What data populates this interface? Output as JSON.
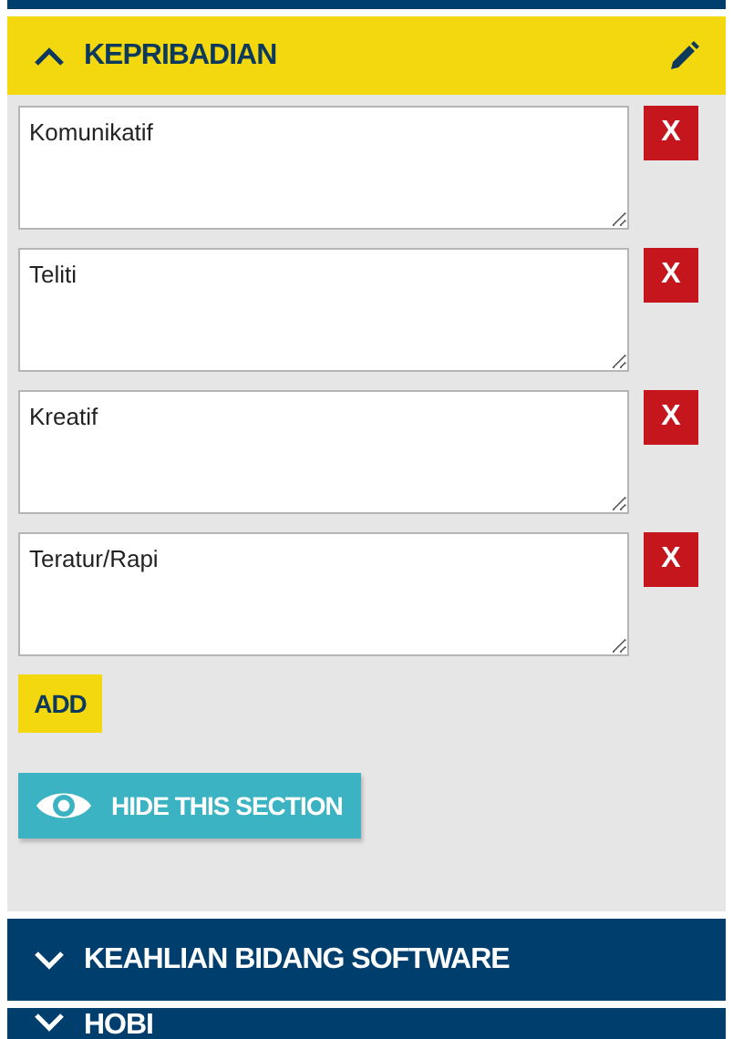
{
  "sections": [
    {
      "title": "KEPRIBADIAN",
      "expanded": true,
      "items": [
        {
          "value": "Komunikatif",
          "remove_label": "X"
        },
        {
          "value": "Teliti",
          "remove_label": "X"
        },
        {
          "value": "Kreatif",
          "remove_label": "X"
        },
        {
          "value": "Teratur/Rapi",
          "remove_label": "X"
        }
      ],
      "add_label": "ADD",
      "hide_label": "HIDE THIS SECTION"
    },
    {
      "title": "KEAHLIAN BIDANG SOFTWARE",
      "expanded": false
    },
    {
      "title": "HOBI",
      "expanded": false
    }
  ]
}
